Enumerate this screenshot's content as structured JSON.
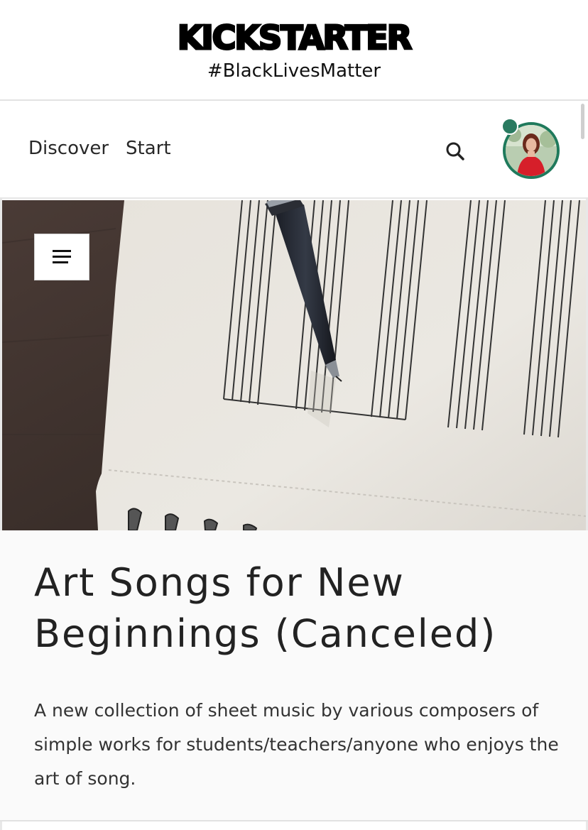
{
  "header": {
    "logo_text": "KICKSTARTER",
    "hashtag": "#BlackLivesMatter"
  },
  "nav": {
    "discover_label": "Discover",
    "start_label": "Start",
    "search_icon": "search-icon",
    "avatar_icon": "user-avatar",
    "notification_color": "#2a7a60"
  },
  "hero": {
    "menu_icon": "menu-icon"
  },
  "project": {
    "title": "Art Songs for New Beginnings (Canceled)",
    "blurb": "A new collection of sheet music by various composers of simple works for students/teachers/anyone who enjoys the art of song."
  },
  "colors": {
    "accent": "#1f7a5c",
    "text": "#282828"
  }
}
